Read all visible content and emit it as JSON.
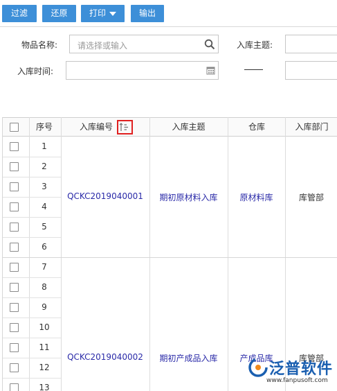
{
  "toolbar": {
    "filter_label": "过滤",
    "reset_label": "还原",
    "print_label": "打印",
    "export_label": "输出"
  },
  "filters": {
    "item_name_label": "物品名称:",
    "item_name_placeholder": "请选择或输入",
    "subject_label": "入库主题:",
    "date_label": "入库时间:"
  },
  "table": {
    "columns": [
      "序号",
      "入库编号",
      "入库主题",
      "仓库",
      "入库部门"
    ],
    "rows": [
      "1",
      "2",
      "3",
      "4",
      "5",
      "6",
      "7",
      "8",
      "9",
      "10",
      "11",
      "12",
      "13"
    ],
    "groups": [
      {
        "code": "QCKC2019040001",
        "subject": "期初原材料入库",
        "warehouse": "原材料库",
        "dept": "库管部"
      },
      {
        "code": "QCKC2019040002",
        "subject": "期初产成品入库",
        "warehouse": "产成品库",
        "dept": "库管部"
      }
    ]
  },
  "watermark": {
    "brand": "泛普软件",
    "url": "www.fanpusoft.com"
  },
  "colors": {
    "button": "#3d8fd8",
    "link": "#2a2aa8",
    "highlight": "#e02020",
    "brand": "#1a5fb0"
  }
}
